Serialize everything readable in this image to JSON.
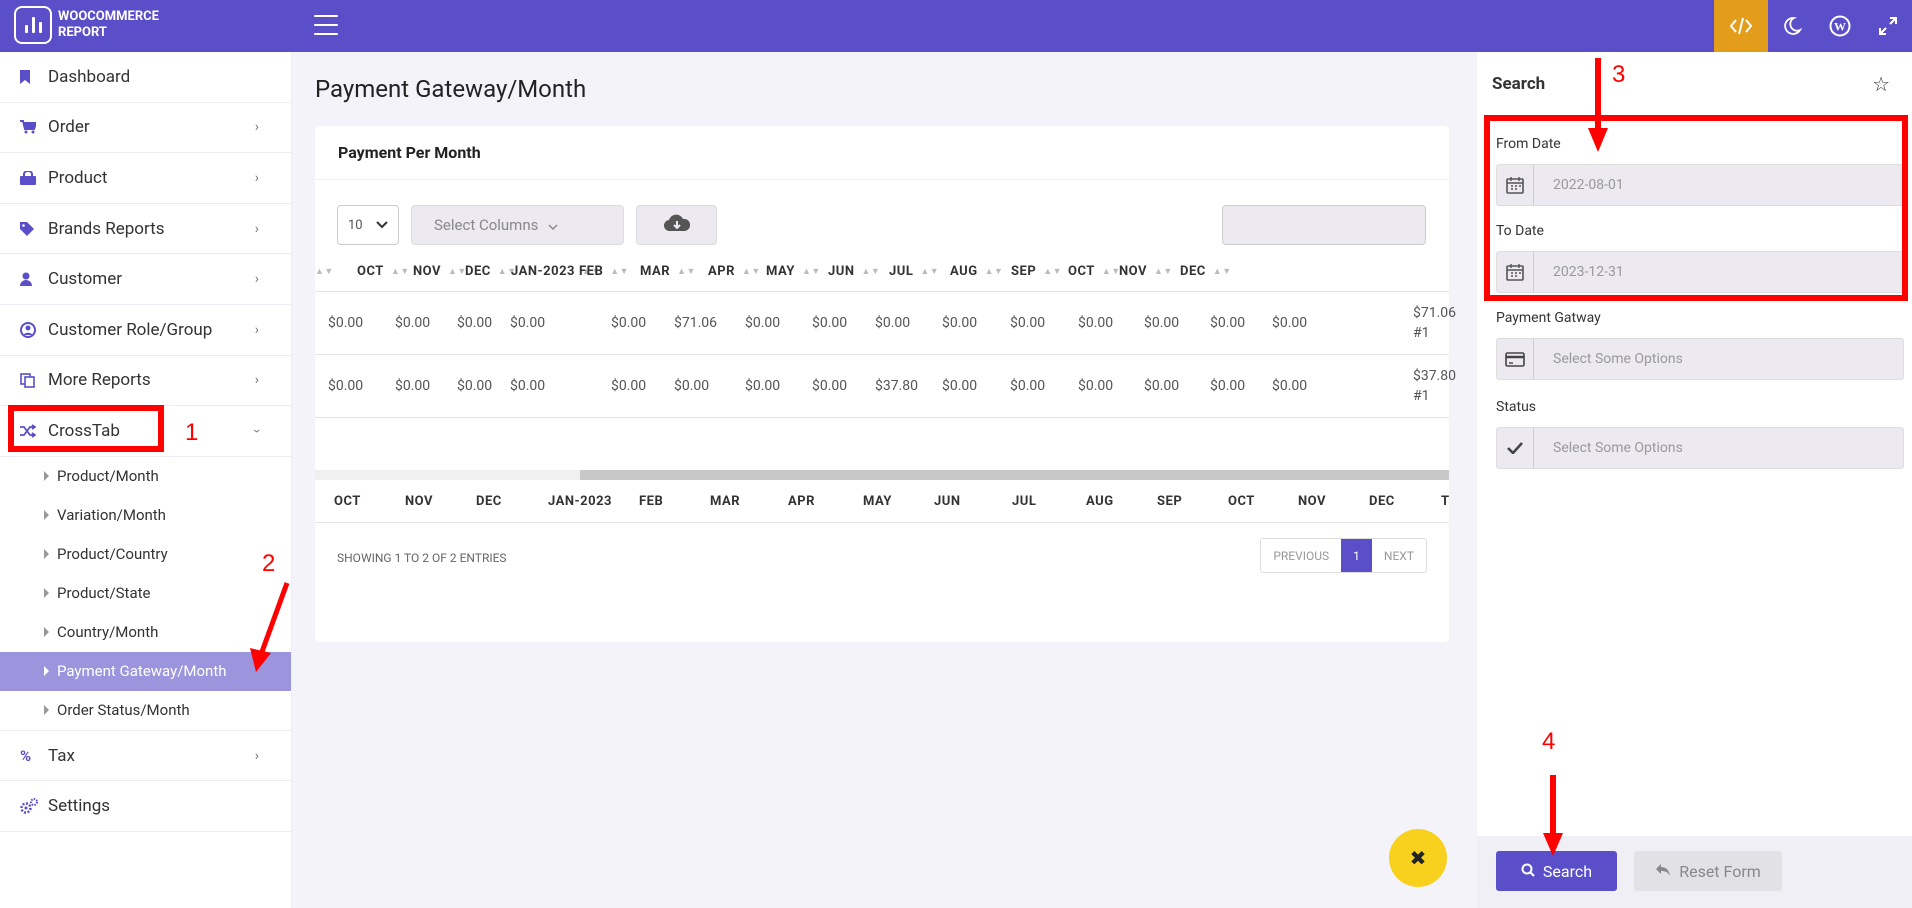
{
  "app": {
    "title_line1": "WOOCOMMERCE",
    "title_line2": "REPORT"
  },
  "topbar": {
    "icons": [
      "code-icon",
      "moon-icon",
      "wordpress-icon",
      "fullscreen-icon"
    ],
    "accent": "#5a4fc8",
    "active_color": "#e49d1a"
  },
  "sidebar": {
    "items": [
      {
        "label": "Dashboard",
        "icon": "bookmark-icon"
      },
      {
        "label": "Order",
        "icon": "cart-icon"
      },
      {
        "label": "Product",
        "icon": "bag-icon"
      },
      {
        "label": "Brands Reports",
        "icon": "tag-icon"
      },
      {
        "label": "Customer",
        "icon": "user-icon"
      },
      {
        "label": "Customer Role/Group",
        "icon": "user-circle-icon"
      },
      {
        "label": "More Reports",
        "icon": "copy-icon"
      },
      {
        "label": "CrossTab",
        "icon": "shuffle-icon"
      }
    ],
    "crosstab_subitems": [
      "Product/Month",
      "Variation/Month",
      "Product/Country",
      "Product/State",
      "Country/Month",
      "Payment Gateway/Month",
      "Order Status/Month"
    ],
    "bottom_items": [
      {
        "label": "Tax",
        "icon": "percent-icon"
      },
      {
        "label": "Settings",
        "icon": "gears-icon"
      }
    ]
  },
  "main": {
    "page_title": "Payment Gateway/Month",
    "card_title": "Payment Per Month",
    "page_length": "10",
    "select_columns": "Select Columns",
    "columns": [
      "OCT",
      "NOV",
      "DEC",
      "JAN-2023",
      "FEB",
      "MAR",
      "APR",
      "MAY",
      "JUN",
      "JUL",
      "AUG",
      "SEP",
      "OCT",
      "NOV",
      "DEC"
    ],
    "rows": [
      {
        "values": [
          "$0.00",
          "$0.00",
          "$0.00",
          "$0.00",
          "$0.00",
          "$71.06",
          "$0.00",
          "$0.00",
          "$0.00",
          "$0.00",
          "$0.00",
          "$0.00",
          "$0.00",
          "$0.00",
          "$0.00"
        ],
        "total": "$71.06",
        "total_note": "#1"
      },
      {
        "values": [
          "$0.00",
          "$0.00",
          "$0.00",
          "$0.00",
          "$0.00",
          "$0.00",
          "$0.00",
          "$0.00",
          "$37.80",
          "$0.00",
          "$0.00",
          "$0.00",
          "$0.00",
          "$0.00",
          "$0.00"
        ],
        "total": "$37.80",
        "total_note": "#1"
      }
    ],
    "footer_extra": "T",
    "showing": "SHOWING 1 TO 2 OF 2 ENTRIES",
    "pager": {
      "previous": "PREVIOUS",
      "current": "1",
      "next": "NEXT"
    },
    "fab_label": "✖"
  },
  "search_panel": {
    "title": "Search",
    "from_date_label": "From Date",
    "from_date_value": "2022-08-01",
    "to_date_label": "To Date",
    "to_date_value": "2023-12-31",
    "payment_label": "Payment Gatway",
    "payment_placeholder": "Select Some Options",
    "status_label": "Status",
    "status_placeholder": "Select Some Options",
    "search_button": "Search",
    "reset_button": "Reset Form"
  },
  "annotations": {
    "n1": "1",
    "n2": "2",
    "n3": "3",
    "n4": "4",
    "color": "#ff0000"
  }
}
